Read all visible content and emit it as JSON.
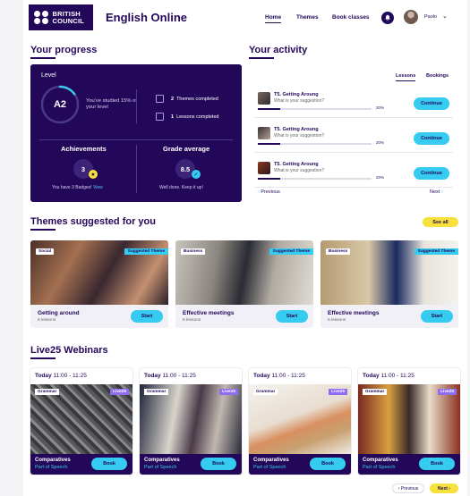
{
  "header": {
    "logo_line1": "BRITISH",
    "logo_line2": "COUNCIL",
    "brand": "English Online",
    "nav": {
      "home": "Home",
      "themes": "Themes",
      "classes": "Book classes"
    },
    "user_name": "Paolo",
    "chevron": "⌄"
  },
  "progress": {
    "title": "Your progress",
    "level_label": "Level",
    "level": "A2",
    "level_percent": 15,
    "studied_text": "You've studied 15% of your level",
    "themes_count": "2",
    "themes_label": "Themes completed",
    "lessons_count": "1",
    "lessons_label": "Lessons completed",
    "achievements_title": "Achievements",
    "badges_count": "3",
    "badges_text": "You have 3 Badges!",
    "view": "View",
    "grade_title": "Grade average",
    "grade": "8.5",
    "grade_text": "Well done. Keep it up!"
  },
  "activity": {
    "title": "Your activity",
    "tabs": {
      "lessons": "Lessons",
      "bookings": "Bookings"
    },
    "items": [
      {
        "title": "T5. Getting Aroung",
        "subtitle": "What is your suggestion?",
        "percent_label": "20%",
        "progress": 0.2,
        "button": "Continue"
      },
      {
        "title": "T5. Getting Aroung",
        "subtitle": "What is your suggestion?",
        "percent_label": "20%",
        "progress": 0.2,
        "button": "Continue"
      },
      {
        "title": "T5. Getting Aroung",
        "subtitle": "What is your suggestion?",
        "percent_label": "20%",
        "progress": 0.2,
        "button": "Continue"
      }
    ],
    "previous": "Previous",
    "next": "Next"
  },
  "themes": {
    "title": "Themes suggested for you",
    "see_all": "See all",
    "cards": [
      {
        "category": "Social",
        "badge": "Suggested Theme",
        "title": "Getting around",
        "lessons": "6 lessons",
        "button": "Start"
      },
      {
        "category": "Business",
        "badge": "Suggested Theme",
        "title": "Effective meetings",
        "lessons": "6 lessons",
        "button": "Start"
      },
      {
        "category": "Business",
        "badge": "Suggested Theme",
        "title": "Effective meetings",
        "lessons": "6 lessons",
        "button": "Start"
      }
    ]
  },
  "webinars": {
    "title": "Live25 Webinars",
    "cards": [
      {
        "day": "Today",
        "time": "11:00 - 11:25",
        "category": "Grammar",
        "live": "Live25",
        "title": "Comparatives",
        "subtitle": "Part of Speech",
        "button": "Book"
      },
      {
        "day": "Today",
        "time": "11:00 - 11:25",
        "category": "Grammar",
        "live": "Live25",
        "title": "Comparatives",
        "subtitle": "Part of Speech",
        "button": "Book"
      },
      {
        "day": "Today",
        "time": "11:00 - 11:25",
        "category": "Grammar",
        "live": "Live25",
        "title": "Comparatives",
        "subtitle": "Part of Speech",
        "button": "Book"
      },
      {
        "day": "Today",
        "time": "11:00 - 11:25",
        "category": "Grammar",
        "live": "Live25",
        "title": "Comparatives",
        "subtitle": "Part of Speech",
        "button": "Book"
      }
    ],
    "previous": "Previous",
    "next": "Next"
  },
  "colors": {
    "primary": "#23085a",
    "accent": "#36cbf0",
    "highlight": "#f7e23d",
    "live": "#8f6cf0"
  },
  "icons": [
    "bell-icon",
    "avatar",
    "chevron-down-icon",
    "star-icon",
    "medal-icon",
    "chevron-left-icon",
    "chevron-right-icon"
  ]
}
